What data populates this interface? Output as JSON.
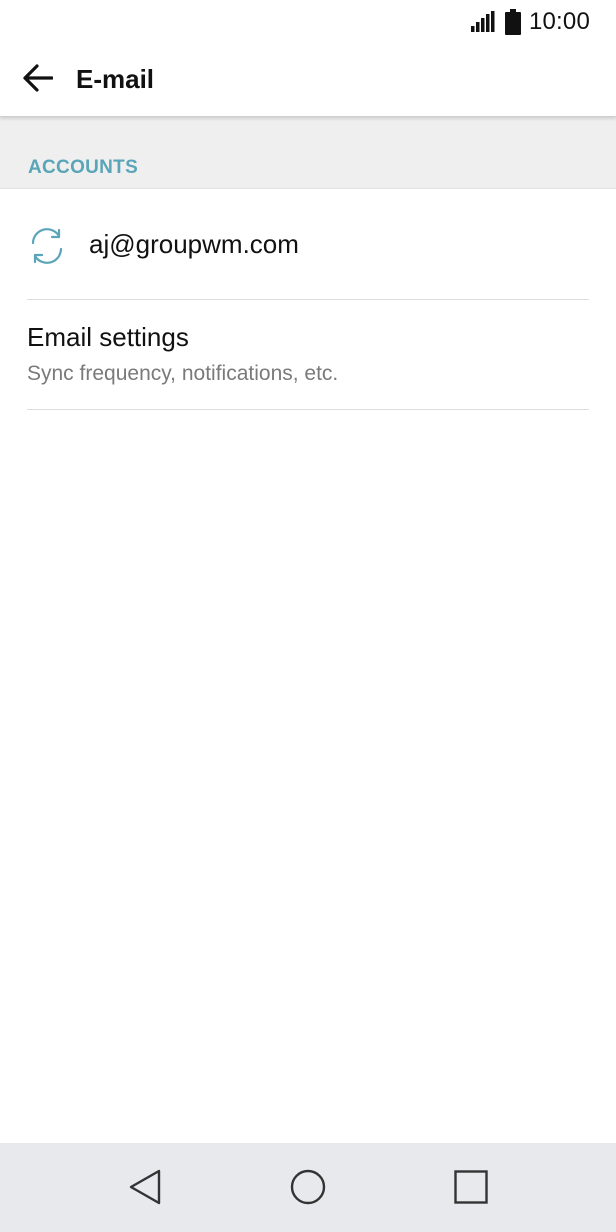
{
  "status_bar": {
    "time": "10:00",
    "signal_icon": "signal-icon",
    "battery_icon": "battery-icon"
  },
  "app_bar": {
    "title": "E-mail",
    "back_icon": "arrow-back-icon"
  },
  "accounts_section": {
    "header": "ACCOUNTS",
    "accent_color": "#5aa5b8",
    "items": [
      {
        "icon": "sync-icon",
        "email": "aj@groupwm.com"
      }
    ]
  },
  "settings": {
    "title": "Email settings",
    "subtitle": "Sync frequency, notifications, etc."
  },
  "nav_bar": {
    "back_icon": "nav-back-icon",
    "home_icon": "nav-home-icon",
    "recents_icon": "nav-recents-icon"
  }
}
